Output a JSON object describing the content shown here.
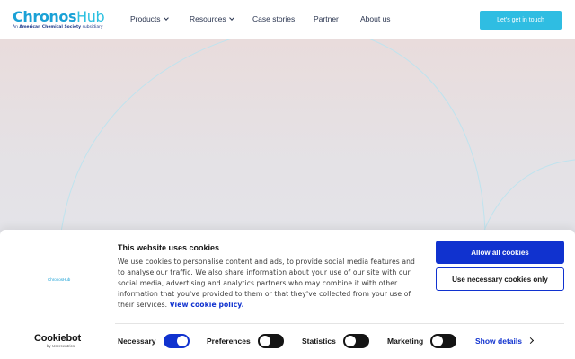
{
  "header": {
    "logo_part1": "Chronos",
    "logo_part2": "Hub",
    "logo_tagline_prefix": "An",
    "logo_tagline_bold": "American Chemical Society",
    "logo_tagline_suffix": "subsidiary",
    "nav": [
      {
        "label": "Products",
        "has_dropdown": true
      },
      {
        "label": "Resources",
        "has_dropdown": true
      },
      {
        "label": "Case stories",
        "has_dropdown": false
      },
      {
        "label": "Partner",
        "has_dropdown": false
      },
      {
        "label": "About us",
        "has_dropdown": false
      }
    ],
    "cta_label": "Let's get in touch"
  },
  "cookie_banner": {
    "small_logo": "ChronosHub",
    "title": "This website uses cookies",
    "body": "We use cookies to personalise content and ads, to provide social media features and to analyse our traffic. We also share information about your use of our site with our social media, advertising and analytics partners who may combine it with other information that you've provided to them or that they've collected from your use of their services.",
    "policy_link": "View cookie policy.",
    "allow_all": "Allow all cookies",
    "use_necessary": "Use necessary cookies only",
    "brand_name": "Cookiebot",
    "brand_sub": "by Usercentrics",
    "toggles": [
      {
        "label": "Necessary",
        "state": "on"
      },
      {
        "label": "Preferences",
        "state": "off"
      },
      {
        "label": "Statistics",
        "state": "off"
      },
      {
        "label": "Marketing",
        "state": "off"
      }
    ],
    "show_details": "Show details"
  },
  "colors": {
    "brand_blue": "#1aa1d6",
    "cta_cyan": "#2fbde2",
    "cookiebot_blue": "#1032cf",
    "toggle_off": "#141414"
  }
}
